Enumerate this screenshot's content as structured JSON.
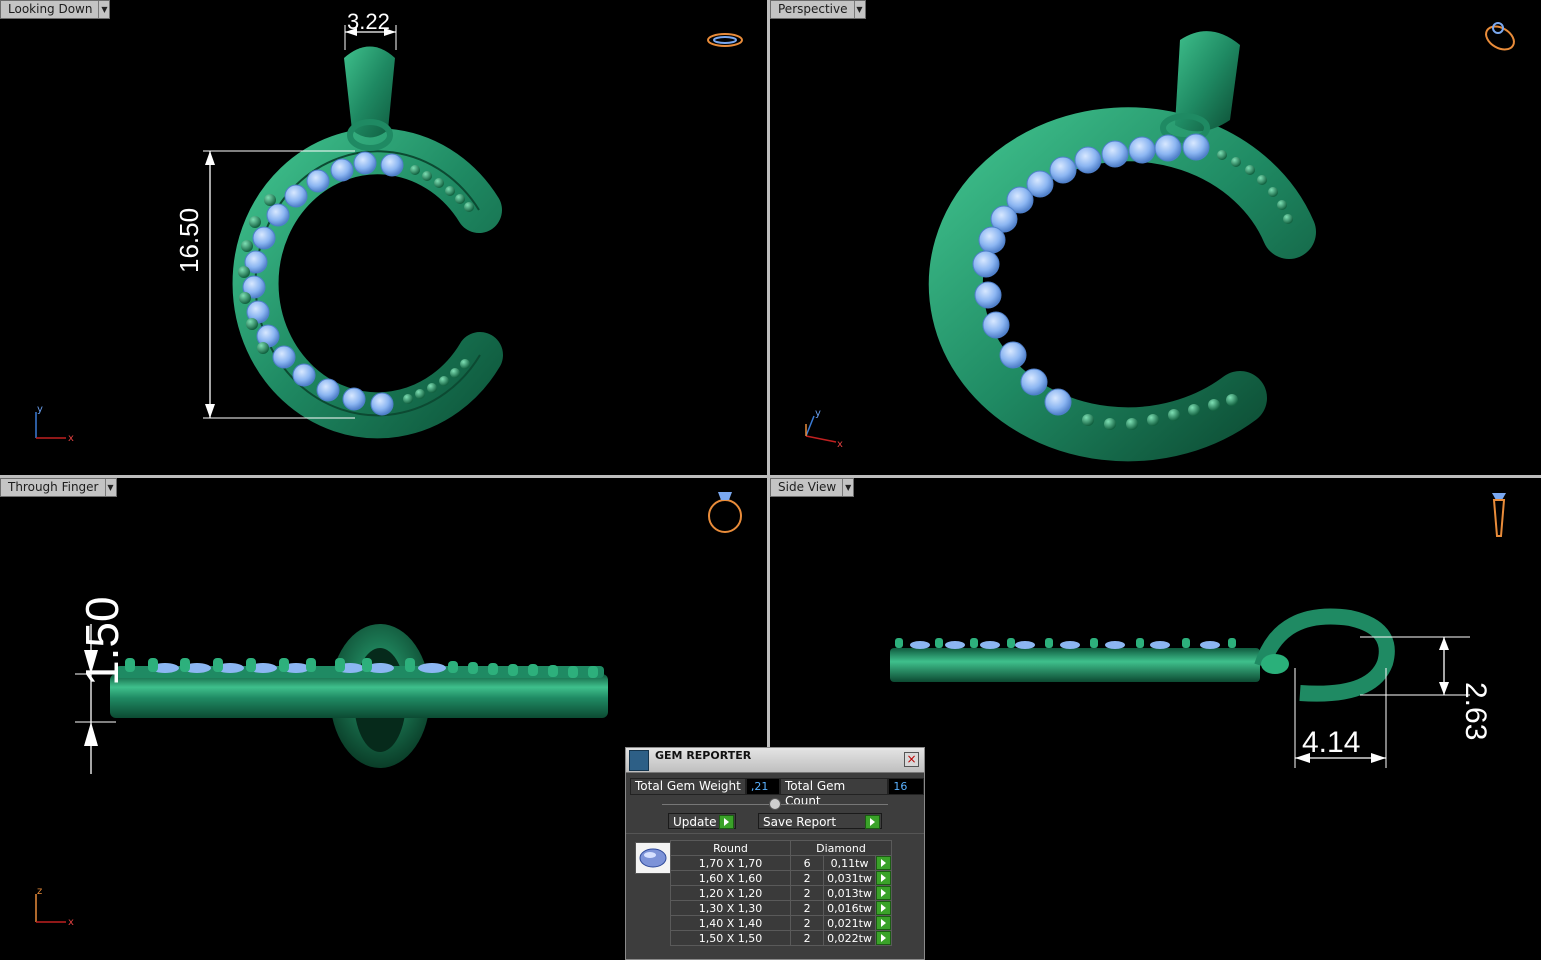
{
  "viewports": {
    "top_left": {
      "label": "Looking Down"
    },
    "top_right": {
      "label": "Perspective"
    },
    "bottom_left": {
      "label": "Through Finger"
    },
    "bottom_right": {
      "label": "Side View"
    }
  },
  "axes": {
    "top_left": {
      "x": "x",
      "y": "y"
    },
    "top_right": {
      "x": "x",
      "y": "y"
    },
    "bottom_left": {
      "x": "x",
      "z": "z"
    }
  },
  "dimensions": {
    "bail_width": "3.22",
    "height": "16.50",
    "thickness": "1.50",
    "bail_depth": "2.63",
    "bail_length": "4.14"
  },
  "gem_reporter": {
    "title": "GEM REPORTER",
    "total_weight_label": "Total Gem Weight",
    "total_weight_value": ",21",
    "total_count_label": "Total Gem Count",
    "total_count_value": "16",
    "update_label": "Update",
    "save_report_label": "Save Report",
    "table_headers": {
      "shape": "Round",
      "material": "Diamond"
    },
    "rows": [
      {
        "size": "1,70 X 1,70",
        "count": "6",
        "weight": "0,11tw"
      },
      {
        "size": "1,60 X 1,60",
        "count": "2",
        "weight": "0,031tw"
      },
      {
        "size": "1,20 X 1,20",
        "count": "2",
        "weight": "0,013tw"
      },
      {
        "size": "1,30 X 1,30",
        "count": "2",
        "weight": "0,016tw"
      },
      {
        "size": "1,40 X 1,40",
        "count": "2",
        "weight": "0,021tw"
      },
      {
        "size": "1,50 X 1,50",
        "count": "2",
        "weight": "0,022tw"
      }
    ]
  },
  "colors": {
    "metal": "#1f8a63",
    "metal_light": "#3fc08c",
    "gem": "#8cb6f2",
    "background": "#000000",
    "view_cube": "#e98c3a"
  }
}
